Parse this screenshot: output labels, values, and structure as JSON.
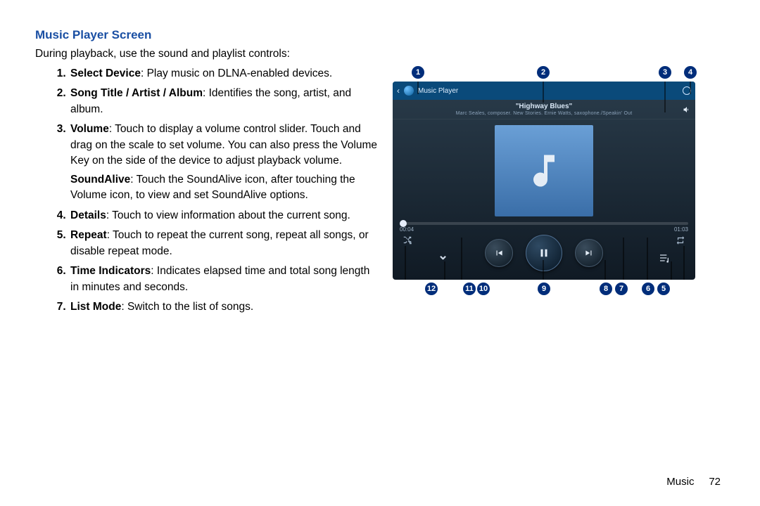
{
  "title": "Music Player Screen",
  "intro": "During playback, use the sound and playlist controls:",
  "items": [
    {
      "boldTerm": "Select Device",
      "desc": ": Play music on DLNA-enabled devices."
    },
    {
      "boldTerm": "Song Title / Artist / Album",
      "desc": ": Identifies the song, artist, and album."
    },
    {
      "boldTerm": "Volume",
      "desc": ": Touch to display a volume control slider. Touch and drag on the scale to set volume. You can also press the Volume Key on the side of the device to adjust playback volume.",
      "subBold": "SoundAlive",
      "subDesc": ": Touch the SoundAlive icon, after touching the Volume icon, to view and set SoundAlive options."
    },
    {
      "boldTerm": "Details",
      "desc": ": Touch to view information about the current song."
    },
    {
      "boldTerm": "Repeat",
      "desc": ": Touch to repeat the current song, repeat all songs, or disable repeat mode."
    },
    {
      "boldTerm": "Time Indicators",
      "desc": ": Indicates elapsed time and total song length in minutes and seconds."
    },
    {
      "boldTerm": "List Mode",
      "desc": ": Switch to the list of songs."
    }
  ],
  "calloutsTop": [
    "1",
    "2",
    "3",
    "4"
  ],
  "calloutsBottom": [
    "12",
    "11",
    "10",
    "9",
    "8",
    "7",
    "6",
    "5"
  ],
  "player": {
    "appName": "Music Player",
    "songTitle": "\"Highway Blues\"",
    "songMeta": "Marc Seales, composer. New Stories. Ernie Watts, saxophone./Speakin' Out",
    "elapsed": "00:04",
    "total": "01:03"
  },
  "footer": {
    "section": "Music",
    "page": "72"
  }
}
